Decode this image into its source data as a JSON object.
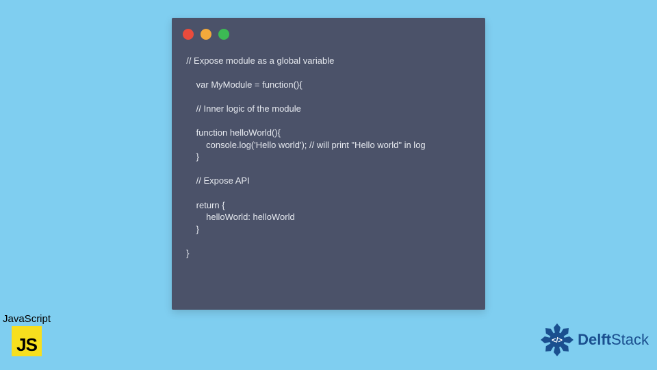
{
  "window": {
    "dots": {
      "red": "#e94b3c",
      "yellow": "#f2a93b",
      "green": "#3cba54"
    }
  },
  "code": "  // Expose module as a global variable\n\n      var MyModule = function(){\n\n      // Inner logic of the module\n\n      function helloWorld(){\n          console.log('Hello world'); // will print \"Hello world\" in log\n      }\n\n      // Expose API\n\n      return {\n          helloWorld: helloWorld\n      }\n\n  }",
  "js_badge": {
    "label": "JavaScript",
    "icon_text": "JS"
  },
  "brand": {
    "name_bold": "Delft",
    "name_rest": "Stack"
  }
}
